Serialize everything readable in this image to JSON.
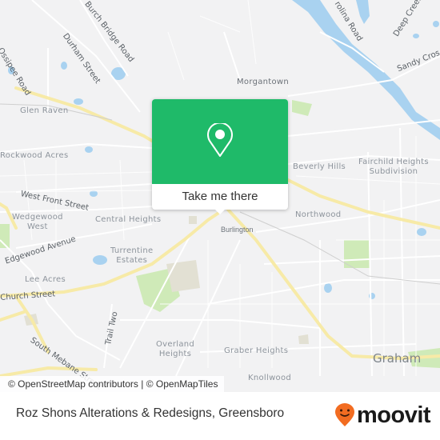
{
  "map": {
    "roads": [
      {
        "name": "burch-bridge-road",
        "label": "Burch Bridge Road"
      },
      {
        "name": "durham-street",
        "label": "Durham Street"
      },
      {
        "name": "ossipee-road",
        "label": "Ossipee Road"
      },
      {
        "name": "carolina-road",
        "label": "rolina Road"
      },
      {
        "name": "deep-creek",
        "label": "Deep Creek C"
      },
      {
        "name": "sandy-cross",
        "label": "Sandy Cros"
      },
      {
        "name": "west-front-street",
        "label": "West Front Street"
      },
      {
        "name": "edgewood-avenue",
        "label": "Edgewood Avenue"
      },
      {
        "name": "church-street",
        "label": "Church Street"
      },
      {
        "name": "south-mebane-street",
        "label": "South Mebane Street"
      },
      {
        "name": "trail-two",
        "label": "Trail Two"
      }
    ],
    "places": [
      {
        "name": "morgantown",
        "label": "Morgantown"
      },
      {
        "name": "glen-raven",
        "label": "Glen Raven"
      },
      {
        "name": "rockwood-acres",
        "label": "Rockwood Acres"
      },
      {
        "name": "beverly-hills",
        "label": "Beverly Hills"
      },
      {
        "name": "fairchild-heights",
        "label": "Fairchild Heights\nSubdivision"
      },
      {
        "name": "wedgewood-west",
        "label": "Wedgewood\nWest"
      },
      {
        "name": "central-heights",
        "label": "Central Heights"
      },
      {
        "name": "northwood",
        "label": "Northwood"
      },
      {
        "name": "turrentine-estates",
        "label": "Turrentine\nEstates"
      },
      {
        "name": "lee-acres",
        "label": "Lee Acres"
      },
      {
        "name": "overland-heights",
        "label": "Overland\nHeights"
      },
      {
        "name": "graber-heights",
        "label": "Graber Heights"
      },
      {
        "name": "knollwood",
        "label": "Knollwood"
      }
    ],
    "towns": [
      {
        "name": "burlington",
        "label": "Burlington"
      }
    ],
    "cities": [
      {
        "name": "graham",
        "label": "Graham"
      }
    ],
    "popup": {
      "button_label": "Take me there",
      "icon": "location-pin-icon",
      "color": "#1fba69"
    },
    "attribution": "© OpenStreetMap contributors | © OpenMapTiles"
  },
  "footer": {
    "place_title": "Roz Shons Alterations & Redesigns, Greensboro",
    "logo_text": "moovit",
    "logo_color": "#f26c21"
  }
}
